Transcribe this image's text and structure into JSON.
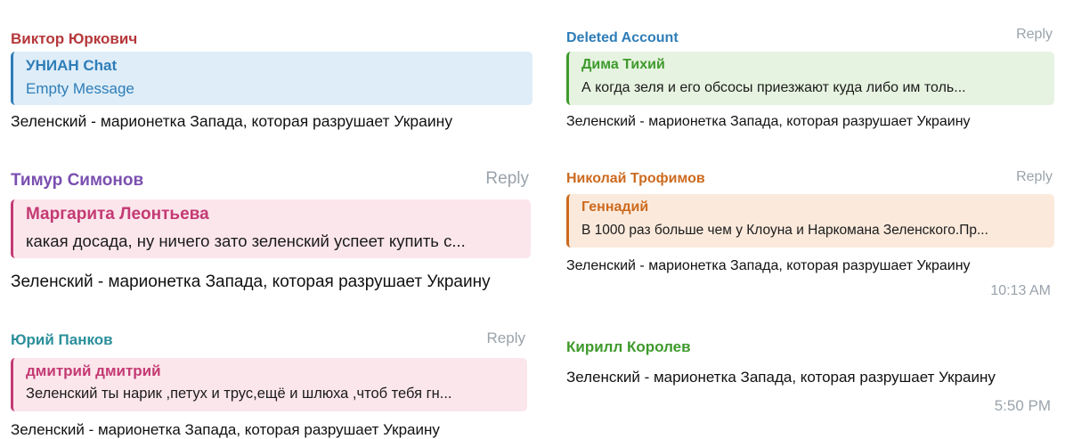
{
  "colors": {
    "red": "#b5383b",
    "blue": "#2e7db8",
    "purple": "#7a4fb0",
    "pink": "#c43a73",
    "teal": "#2b8f9a",
    "green": "#3e9a2c",
    "orange": "#cc6a1e",
    "reply_gray": "#9aa3ab",
    "quote_blue_bg": "#deedf8",
    "quote_pink_bg": "#fbe6ec",
    "quote_green_bg": "#e6f3e0",
    "quote_orange_bg": "#fbeadc"
  },
  "left": {
    "msg1": {
      "author": "Виктор Юркович",
      "quote_name": "УНИАН Chat",
      "quote_text": "Empty Message",
      "text": "Зеленский - марионетка Запада, которая разрушает Украину"
    },
    "msg2": {
      "author": "Тимур Симонов",
      "reply": "Reply",
      "quote_name": "Маргарита Леонтьева",
      "quote_text": "какая досада,  ну ничего зато зеленский успеет купить с...",
      "text": "Зеленский - марионетка Запада, которая разрушает Украину"
    },
    "msg3": {
      "author": "Юрий Панков",
      "reply": "Reply",
      "quote_name": "дмитрий дмитрий",
      "quote_text": "Зеленский ты нарик ,петух и трус,ещё и шлюха ,чтоб тебя гн...",
      "text": "Зеленский - марионетка Запада, которая разрушает Украину"
    }
  },
  "right": {
    "msg1": {
      "author": "Deleted Account",
      "reply": "Reply",
      "quote_name": "Дима Тихий",
      "quote_text": "А когда зеля и его обсосы приезжают куда либо им толь...",
      "text": "Зеленский - марионетка Запада, которая разрушает Украину"
    },
    "msg2": {
      "author": "Николай Трофимов",
      "reply": "Reply",
      "quote_name": "Геннадий",
      "quote_text": "В 1000 раз больше чем у Клоуна и Наркомана Зеленского.Пр...",
      "text": "Зеленский - марионетка Запада, которая разрушает Украину",
      "time": "10:13 AM"
    },
    "msg3": {
      "author": "Кирилл Королев",
      "text": "Зеленский - марионетка Запада, которая разрушает Украину",
      "time": "5:50 PM"
    }
  }
}
